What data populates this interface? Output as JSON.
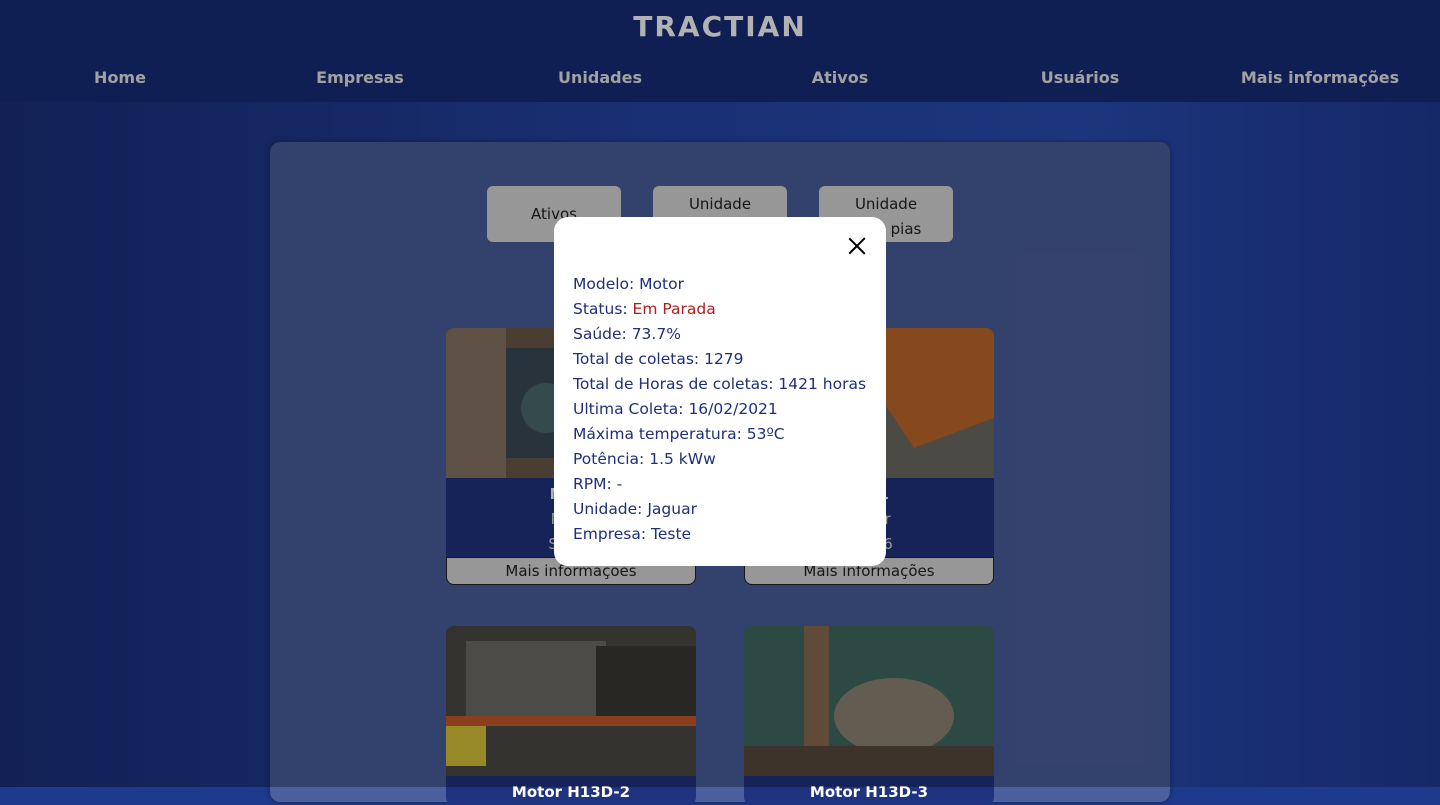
{
  "header": {
    "logo": "TRACTIAN",
    "nav": [
      "Home",
      "Empresas",
      "Unidades",
      "Ativos",
      "Usuários",
      "Mais informações"
    ]
  },
  "filters": {
    "ativos": "Ativos",
    "unidade_1_line1": "Unidade",
    "unidade_2_line1": "Unidade",
    "unidade_2_line2": "pias"
  },
  "cards": [
    {
      "title": "Moto",
      "model": "Mode",
      "sensor": "Senso",
      "button": "Mais informações"
    },
    {
      "title": "2D-1",
      "model": "Motor",
      "sensor": "S1636",
      "button": "Mais informações"
    },
    {
      "title": "Motor H13D-2",
      "button": "Mais informações"
    },
    {
      "title": "Motor H13D-3",
      "button": "Mais informações"
    }
  ],
  "modal": {
    "rows": [
      {
        "label": "Modelo: ",
        "value": "Motor"
      },
      {
        "label": "Status: ",
        "value": "Em Parada"
      },
      {
        "label": "Saúde: ",
        "value": "73.7%"
      },
      {
        "label": "Total de coletas: ",
        "value": "1279"
      },
      {
        "label": "Total de Horas de coletas: ",
        "value": "1421 horas"
      },
      {
        "label": "Ultima Coleta: ",
        "value": "16/02/2021"
      },
      {
        "label": "Máxima temperatura: ",
        "value": "53ºC"
      },
      {
        "label": "Potência: ",
        "value": "1.5 kWw"
      },
      {
        "label": "RPM: ",
        "value": "-"
      },
      {
        "label": "Unidade: ",
        "value": "Jaguar"
      },
      {
        "label": "Empresa: ",
        "value": "Teste"
      }
    ],
    "status_color": "#b01c1c"
  }
}
